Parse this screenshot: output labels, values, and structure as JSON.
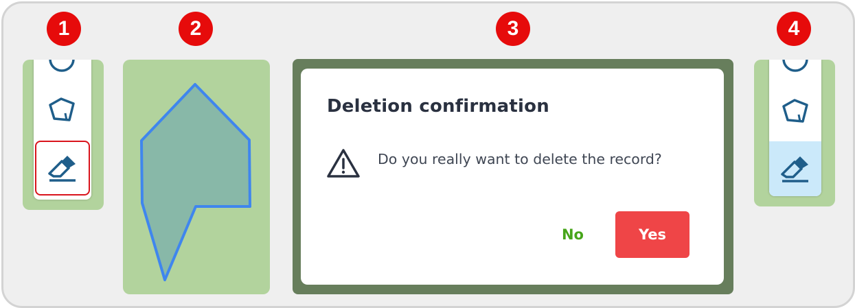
{
  "steps": [
    "1",
    "2",
    "3",
    "4"
  ],
  "toolbar": {
    "tools": [
      {
        "icon": "circle-draw-icon"
      },
      {
        "icon": "polygon-draw-icon"
      },
      {
        "icon": "eraser-icon"
      }
    ]
  },
  "dialog": {
    "title": "Deletion confirmation",
    "message": "Do you really want to delete the record?",
    "no_label": "No",
    "yes_label": "Yes"
  },
  "colors": {
    "badge": "#e60b0b",
    "map": "#b2d39d",
    "polygon_stroke": "#3f86ee",
    "polygon_fill": "#88b8a8",
    "no_text": "#47a51a",
    "yes_bg": "#ef4547",
    "active_tool": "#cbe9fa",
    "icon": "#1f5e8a"
  }
}
